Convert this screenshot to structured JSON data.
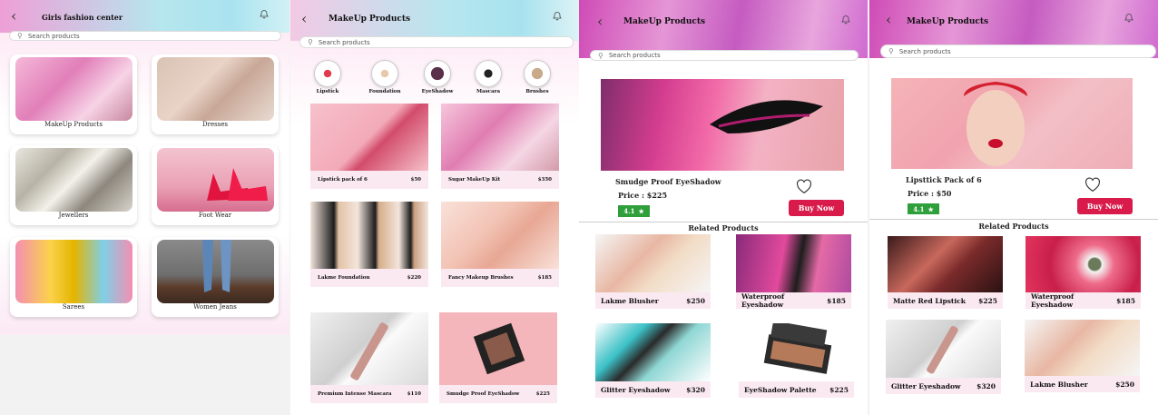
{
  "screen1": {
    "title": "Girls fashion center",
    "search_placeholder": "Search products",
    "categories": [
      {
        "label": "MakeUp Products"
      },
      {
        "label": "Dresses"
      },
      {
        "label": "Jewellers"
      },
      {
        "label": "Foot Wear"
      },
      {
        "label": "Sarees"
      },
      {
        "label": "Women Jeans"
      }
    ]
  },
  "screen2": {
    "title": "MakeUp Products",
    "search_placeholder": "Search products",
    "subcategories": [
      {
        "label": "Lipstick"
      },
      {
        "label": "Foundation"
      },
      {
        "label": "EyeShadow"
      },
      {
        "label": "Mascara"
      },
      {
        "label": "Brushes"
      }
    ],
    "products": [
      {
        "name": "Lipstick pack of 6",
        "price": "$50"
      },
      {
        "name": "Sugar MakeUp Kit",
        "price": "$350"
      },
      {
        "name": "Lakme Foundation",
        "price": "$220"
      },
      {
        "name": "Fancy Makeup Brushes",
        "price": "$185"
      },
      {
        "name": "Premium Intense Mascara",
        "price": "$110"
      },
      {
        "name": "Smudge Proof EyeShadow",
        "price": "$225"
      }
    ]
  },
  "screen3": {
    "title": "MakeUp Products",
    "search_placeholder": "Search products",
    "product_name": "Smudge Proof EyeShadow",
    "price": "Price  :  $225",
    "rating": "4.1",
    "buy_label": "Buy Now",
    "related_title": "Related Products",
    "related": [
      {
        "name": "Lakme Blusher",
        "price": "$250"
      },
      {
        "name": "Waterproof Eyeshadow",
        "price": "$185"
      },
      {
        "name": "Glitter Eyeshadow",
        "price": "$320"
      },
      {
        "name": "EyeShadow Palette",
        "price": "$225"
      }
    ]
  },
  "screen4": {
    "title": "MakeUp Products",
    "search_placeholder": "Search products",
    "product_name": "Lipsttick  Pack  of  6",
    "price": "Price  :  $50",
    "rating": "4.1",
    "buy_label": "Buy Now",
    "related_title": "Related Products",
    "related": [
      {
        "name": "Matte Red Lipstick",
        "price": "$225"
      },
      {
        "name": "Waterproof Eyeshadow",
        "price": "$185"
      },
      {
        "name": "Glitter Eyeshadow",
        "price": "$320"
      },
      {
        "name": "Lakme Blusher",
        "price": "$250"
      }
    ]
  },
  "colors": {
    "buy_button": "#d81b4a",
    "rating_badge": "#2e9f3a",
    "card_bar": "#fbe9f2"
  },
  "icons": [
    "back-arrow-icon",
    "bell-icon",
    "search-icon",
    "heart-icon",
    "star-icon"
  ]
}
